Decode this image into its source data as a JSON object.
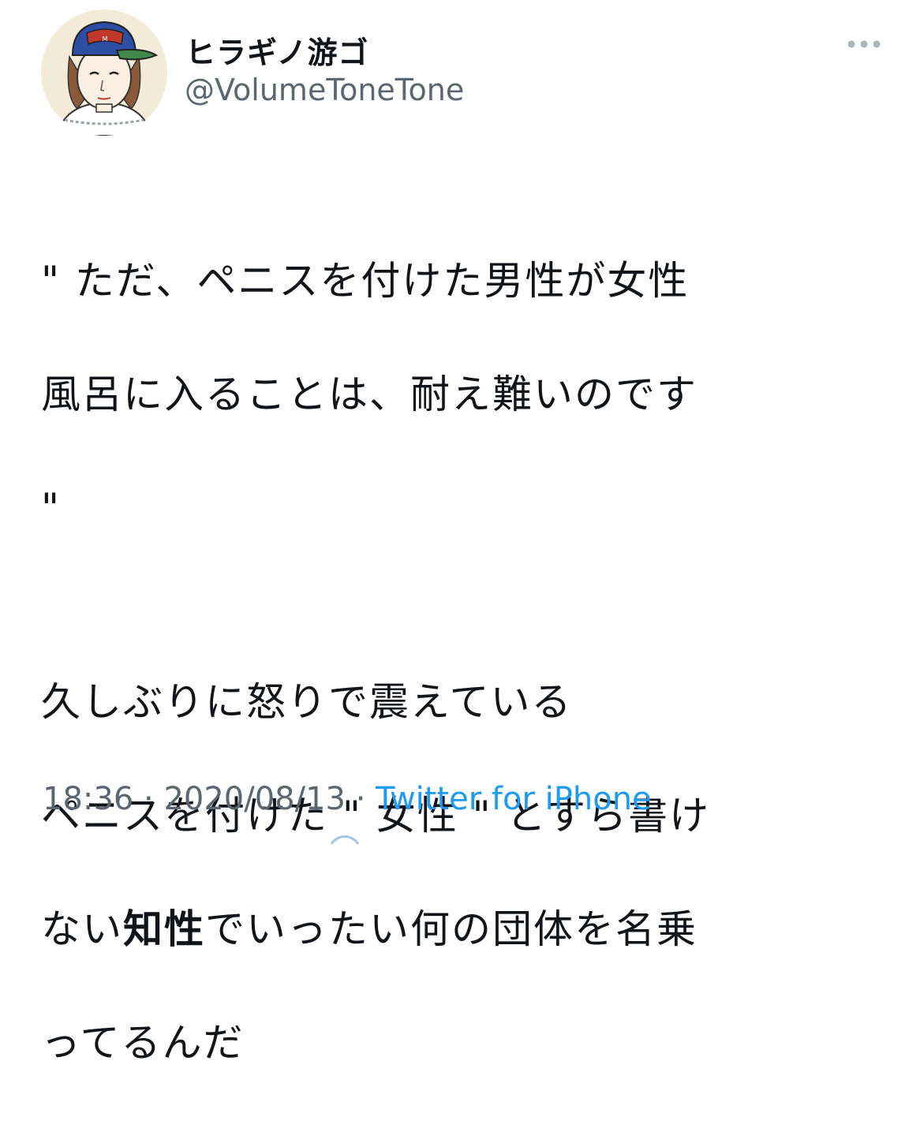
{
  "user": {
    "display_name": "ヒラギノ游ゴ",
    "handle": "@VolumeToneTone",
    "avatar_icon": "cartoon-avatar-with-cap"
  },
  "tweet": {
    "lines": [
      "\" ただ、ペニスを付けた男性が女性",
      "風呂に入ることは、耐え難いのです",
      "\"",
      "久しぶりに怒りで震えている",
      "ペニスを付けた \" 女性 \" とすら書け",
      "ない",
      "知性",
      "でいったい何の団体を名乗",
      "ってるんだ"
    ]
  },
  "meta": {
    "time": "18:36",
    "sep1": " · ",
    "date": "2020/08/13",
    "sep2": " · ",
    "source": "Twitter for iPhone"
  },
  "colors": {
    "text": "#111418",
    "secondary": "#5b6670",
    "link": "#1d9bf0"
  },
  "icons": {
    "more": "more-dots-icon",
    "loading": "loading-spinner-icon"
  }
}
